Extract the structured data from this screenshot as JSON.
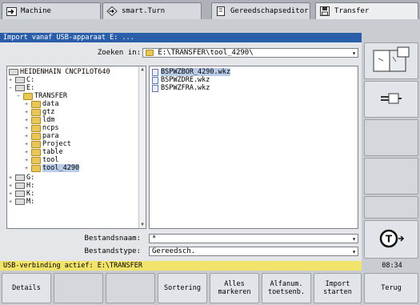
{
  "tabs": [
    {
      "label": "Machine",
      "icon": "arrow-right-box-icon"
    },
    {
      "label": "smart.Turn",
      "icon": "diamond-arrow-icon"
    },
    {
      "label": "Gereedschapseditor",
      "icon": "tool-editor-icon"
    },
    {
      "label": "Transfer",
      "icon": "floppy-disk-icon"
    }
  ],
  "dialog": {
    "title": "Import vanaf USB-apparaat E: ...",
    "search_label": "Zoeken in:",
    "search_value": "E:\\TRANSFER\\tool_4290\\",
    "filename_label": "Bestandsnaam:",
    "filename_value": "*",
    "filetype_label": "Bestandstype:",
    "filetype_value": "Gereedsch."
  },
  "tree": [
    {
      "label": "HEIDENHAIN CNCPILOT640",
      "icon": "drive"
    },
    {
      "label": "C:",
      "icon": "drive"
    },
    {
      "label": "E:",
      "icon": "drive"
    },
    {
      "label": "TRANSFER",
      "icon": "folder"
    },
    {
      "label": "data",
      "icon": "folder"
    },
    {
      "label": "gtz",
      "icon": "folder"
    },
    {
      "label": "ldm",
      "icon": "folder"
    },
    {
      "label": "ncps",
      "icon": "folder"
    },
    {
      "label": "para",
      "icon": "folder"
    },
    {
      "label": "Project",
      "icon": "folder"
    },
    {
      "label": "table",
      "icon": "folder"
    },
    {
      "label": "tool",
      "icon": "folder"
    },
    {
      "label": "tool_4290",
      "icon": "folder"
    },
    {
      "label": "G:",
      "icon": "drive"
    },
    {
      "label": "H:",
      "icon": "drive"
    },
    {
      "label": "K:",
      "icon": "drive"
    },
    {
      "label": "M:",
      "icon": "drive"
    }
  ],
  "files": [
    "BSPWZBOR_4290.wkz",
    "BSPWZDRE.wkz",
    "BSPWZFRA.wkz"
  ],
  "status": {
    "message": "USB-verbinding actief: E:\\TRANSFER",
    "clock": "08:34"
  },
  "softkeys": [
    "Details",
    "",
    "",
    "Sortering",
    "Alles\nmarkeren",
    "Alfanum.\ntoetsenb.",
    "Import\nstarten",
    "Terug"
  ]
}
